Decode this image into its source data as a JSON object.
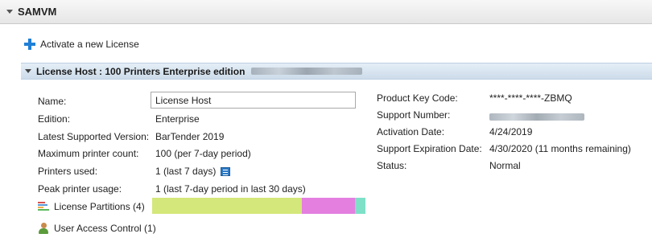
{
  "header": {
    "title": "SAMVM"
  },
  "activate": {
    "label": "Activate a new License"
  },
  "license": {
    "title": "License Host : 100 Printers Enterprise edition",
    "fields": {
      "name_label": "Name:",
      "name_value": "License Host",
      "edition_label": "Edition:",
      "edition_value": "Enterprise",
      "latest_label": "Latest Supported Version:",
      "latest_value": "BarTender 2019",
      "max_label": "Maximum printer count:",
      "max_value": "100   (per 7-day period)",
      "used_label": "Printers used:",
      "used_value": "1   (last 7 days)",
      "peak_label": "Peak printer usage:",
      "peak_value": "1   (last 7-day period in last 30 days)"
    },
    "right": {
      "product_key_label": "Product Key Code:",
      "product_key_value": "****-****-****-ZBMQ",
      "support_number_label": "Support Number:",
      "activation_label": "Activation Date:",
      "activation_value": "4/24/2019",
      "support_exp_label": "Support Expiration Date:",
      "support_exp_value": "4/30/2020 (11 months remaining)",
      "status_label": "Status:",
      "status_value": "Normal"
    }
  },
  "partitions": {
    "label": "License Partitions (4)",
    "segments": [
      {
        "share": 0.7,
        "color": "#d4e77a"
      },
      {
        "share": 0.25,
        "color": "#e47fe0"
      },
      {
        "share": 0.05,
        "color": "#7fe0c8"
      }
    ]
  },
  "uac": {
    "label": "User Access Control (1)"
  },
  "icons": {
    "header_toggle": "collapse-triangle-icon",
    "activate": "plus-icon",
    "license_toggle": "collapse-triangle-icon",
    "printers_used": "list-details-icon",
    "partitions": "partition-bars-icon",
    "uac": "user-icon"
  },
  "colors": {
    "accent": "#1f7fd6",
    "header_bar": "#cddcea"
  }
}
